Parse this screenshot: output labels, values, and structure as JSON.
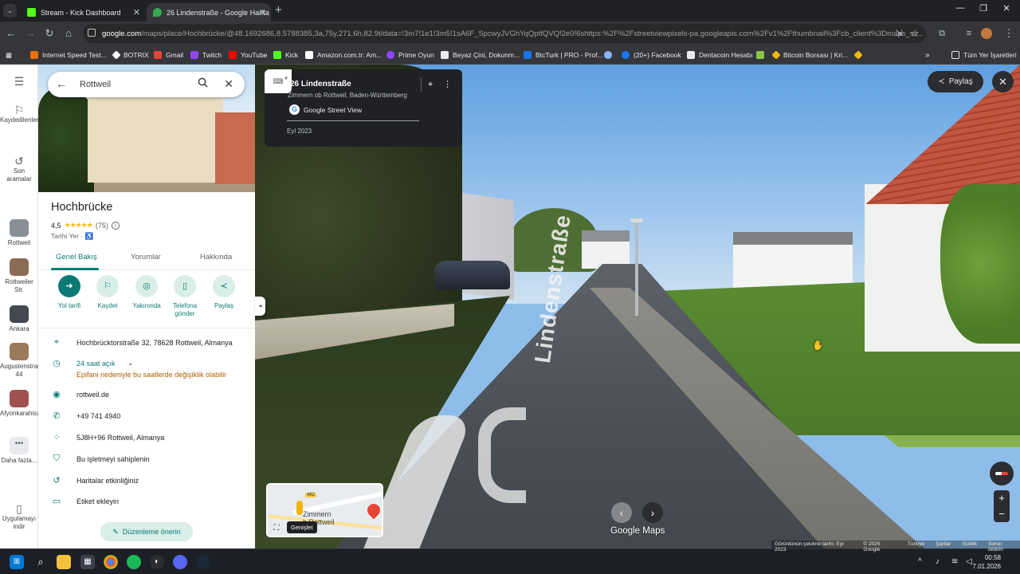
{
  "browser": {
    "tabs": [
      {
        "title": "Stream - Kick Dashboard",
        "active": false,
        "favicon_color": "#53fc18"
      },
      {
        "title": "26 Lindenstraße - Google Harita",
        "active": true,
        "favicon_color": "#34a853"
      }
    ],
    "url_site": "google.com",
    "url_rest": "/maps/place/Hochbrücke/@48.1692686,8.5788385,3a,75y,271.6h,82.9t/data=!3m7!1e1!3m5!1sA6F_SpcwyJVGhYqQptfQVQ!2e0!6shttps:%2F%2Fstreetviewpixels-pa.googleapis.com%2Fv1%2Fthumbnail%3Fcb_client%3Dmaps_sv...",
    "bookmarks": [
      {
        "label": "Internet Speed Test...",
        "color": "#e8710a"
      },
      {
        "label": "BOTRIX",
        "color": "#ffffff"
      },
      {
        "label": "Gmail",
        "color": "#ea4335"
      },
      {
        "label": "Twitch",
        "color": "#9146ff"
      },
      {
        "label": "YouTube",
        "color": "#ff0000"
      },
      {
        "label": "Kick",
        "color": "#53fc18"
      },
      {
        "label": "Amazon.com.tr: Am...",
        "color": "#ffffff"
      },
      {
        "label": "Prime Oyun",
        "color": "#9146ff"
      },
      {
        "label": "Beyaz Çini, Dokunm...",
        "color": "#e8eaed"
      },
      {
        "label": "BtcTurk | PRO - Prof...",
        "color": "#1a73e8"
      },
      {
        "label": "",
        "color": "#8ab4f8"
      },
      {
        "label": "(20+) Facebook",
        "color": "#1877f2"
      },
      {
        "label": "Dentacoin Hesabı",
        "color": "#e8eaed"
      },
      {
        "label": "",
        "color": "#8bc34a"
      },
      {
        "label": "Bitcoin Borsası | Kri...",
        "color": "#f0b90b"
      },
      {
        "label": "",
        "color": "#f0b90b"
      }
    ],
    "all_bookmarks_label": "Tüm Yer İşaretleri"
  },
  "rail": {
    "saved": "Kaydedilenler",
    "recent": "Son aramalar",
    "history": [
      {
        "label": "Rottweil",
        "color": "#8a8f96"
      },
      {
        "label": "Rottweiler Str.",
        "color": "#8a6b55"
      },
      {
        "label": "Ankara",
        "color": "#44484f"
      },
      {
        "label": "Augustenstraße 44",
        "color": "#9b7a5a"
      },
      {
        "label": "Afyonkarahisar...",
        "color": "#a05050"
      }
    ],
    "more": "Daha fazla...",
    "get_app": "Uygulamayı indir"
  },
  "panel": {
    "search_value": "Rottweil",
    "title": "Hochbrücke",
    "rating": "4,5",
    "stars": "★★★★★",
    "reviews": "(75)",
    "type": "Tarihi Yer",
    "accessibility": "♿",
    "tabs": [
      "Genel Bakış",
      "Yorumlar",
      "Hakkında"
    ],
    "actions": [
      {
        "label": "Yol tarifi",
        "icon": "➜"
      },
      {
        "label": "Kaydet",
        "icon": "⚐"
      },
      {
        "label": "Yakınında",
        "icon": "◎"
      },
      {
        "label": "Telefona gönder",
        "icon": "▯"
      },
      {
        "label": "Paylaş",
        "icon": "≺"
      }
    ],
    "address": "Hochbrücktorstraße 32, 78628 Rottweil, Almanya",
    "hours": "24 saat açık",
    "hours_warning": "Epifani nedeniyle bu saatlerde değişiklik olabilir",
    "website": "rottweil.de",
    "phone": "+49 741 4940",
    "plus_code": "5J8H+96 Rottweil, Almanya",
    "claim": "Bu işletmeyi sahiplenin",
    "activity": "Haritalar etkinliğiniz",
    "label": "Etiket ekleyin",
    "suggest_edit": "Düzenleme önerin"
  },
  "streetview": {
    "title": "26 Lindenstraße",
    "subtitle": "Zimmern ob Rottweil, Baden-Württemberg",
    "source": "Google Street View",
    "date": "Eyl 2023",
    "share": "Paylaş",
    "street_text": "Lindenstraße",
    "minimap_label": "Zimmern\nb Rottweil",
    "minimap_shield": "462",
    "expand_tooltip": "Genişlet",
    "brand": "Google Maps",
    "footer": [
      "Görüntünün çekilme tarihi: Eyl 2023",
      "© 2026 Google",
      "Türkiye",
      "Şartlar",
      "Gizlilik",
      "Sorun bildirin"
    ]
  },
  "taskbar": {
    "time": "00:58",
    "date": "7.01.2026"
  }
}
